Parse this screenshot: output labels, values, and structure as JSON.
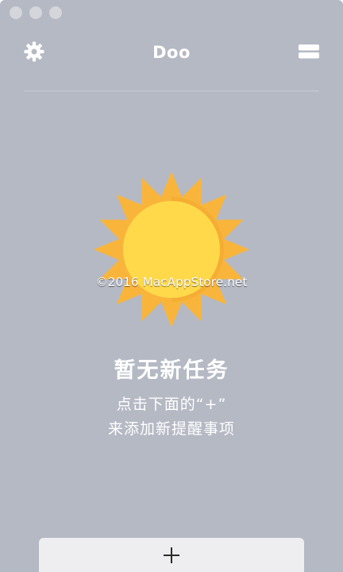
{
  "window": {
    "title": "Doo"
  },
  "header": {
    "settings_icon": "gear-icon",
    "menu_icon": "menu-icon"
  },
  "empty_state": {
    "illustration": "sun-icon",
    "watermark": "©2016 MacAppStore.net",
    "title": "暂无新任务",
    "line1": "点击下面的“+”",
    "line2": "来添加新提醒事项"
  },
  "footer": {
    "add_icon": "plus-icon"
  },
  "colors": {
    "background": "#b5b9c4",
    "sun_core": "#ffd94a",
    "sun_rays": "#f9b53b",
    "button": "#eeeef0"
  }
}
